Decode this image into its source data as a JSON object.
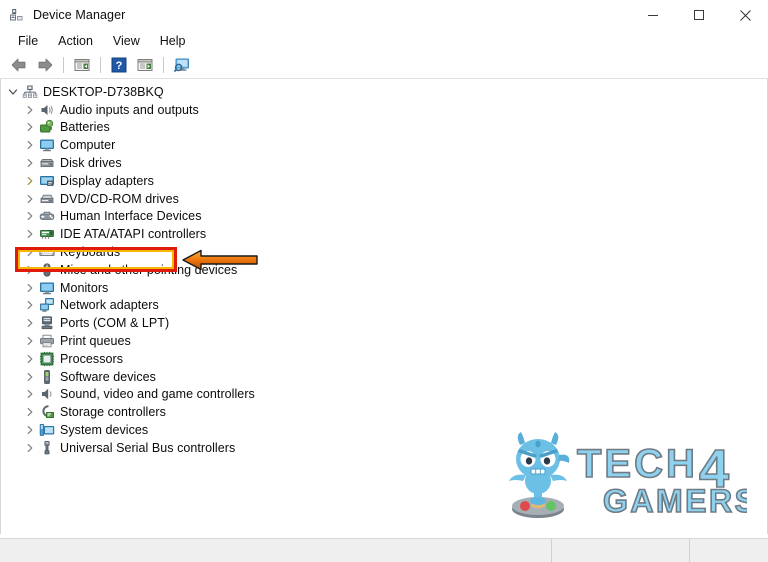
{
  "window": {
    "title": "Device Manager",
    "icon": "device-manager-icon",
    "controls": [
      {
        "name": "minimize-button",
        "glyph": "minimize"
      },
      {
        "name": "maximize-button",
        "glyph": "maximize"
      },
      {
        "name": "close-button",
        "glyph": "close"
      }
    ]
  },
  "menu": {
    "items": [
      {
        "label": "File"
      },
      {
        "label": "Action"
      },
      {
        "label": "View"
      },
      {
        "label": "Help"
      }
    ]
  },
  "toolbar": {
    "buttons": [
      {
        "name": "back-button",
        "icon": "back-arrow-icon"
      },
      {
        "name": "forward-button",
        "icon": "forward-arrow-icon"
      },
      {
        "name": "separator-1",
        "icon": "separator"
      },
      {
        "name": "properties-button",
        "icon": "properties-icon"
      },
      {
        "name": "separator-2",
        "icon": "separator"
      },
      {
        "name": "help-button",
        "icon": "help-question-icon"
      },
      {
        "name": "update-driver-button",
        "icon": "update-driver-icon"
      },
      {
        "name": "separator-3",
        "icon": "separator"
      },
      {
        "name": "scan-hardware-changes-button",
        "icon": "scan-monitor-icon"
      }
    ]
  },
  "tree": {
    "root": {
      "label": "DESKTOP-D738BKQ",
      "icon": "computer-root-icon",
      "expanded": true
    },
    "nodes": [
      {
        "label": "Audio inputs and outputs",
        "icon": "speaker-icon"
      },
      {
        "label": "Batteries",
        "icon": "battery-icon"
      },
      {
        "label": "Computer",
        "icon": "monitor-icon"
      },
      {
        "label": "Disk drives",
        "icon": "disk-drive-icon"
      },
      {
        "label": "Display adapters",
        "icon": "display-adapter-icon",
        "highlighted": true
      },
      {
        "label": "DVD/CD-ROM drives",
        "icon": "dvd-drive-icon"
      },
      {
        "label": "Human Interface Devices",
        "icon": "hid-icon"
      },
      {
        "label": "IDE ATA/ATAPI controllers",
        "icon": "ide-controller-icon"
      },
      {
        "label": "Keyboards",
        "icon": "keyboard-icon"
      },
      {
        "label": "Mice and other pointing devices",
        "icon": "mouse-icon"
      },
      {
        "label": "Monitors",
        "icon": "monitor-icon"
      },
      {
        "label": "Network adapters",
        "icon": "network-adapter-icon"
      },
      {
        "label": "Ports (COM & LPT)",
        "icon": "port-icon"
      },
      {
        "label": "Print queues",
        "icon": "printer-icon"
      },
      {
        "label": "Processors",
        "icon": "processor-icon"
      },
      {
        "label": "Software devices",
        "icon": "software-device-icon"
      },
      {
        "label": "Sound, video and game controllers",
        "icon": "sound-icon"
      },
      {
        "label": "Storage controllers",
        "icon": "storage-controller-icon"
      },
      {
        "label": "System devices",
        "icon": "system-device-icon"
      },
      {
        "label": "Universal Serial Bus controllers",
        "icon": "usb-icon"
      }
    ]
  },
  "annotation": {
    "highlight_border_color": "#e01b0e",
    "highlight_inner_color": "#f5b800",
    "arrow_color": "#f07a10",
    "arrow_direction": "left"
  },
  "watermark": {
    "brand_line1": "TECH",
    "brand_digit": "4",
    "brand_line2": "GAMERS",
    "color": "#76c7e8"
  },
  "status_bar": {
    "panels": [
      "",
      "",
      ""
    ]
  }
}
